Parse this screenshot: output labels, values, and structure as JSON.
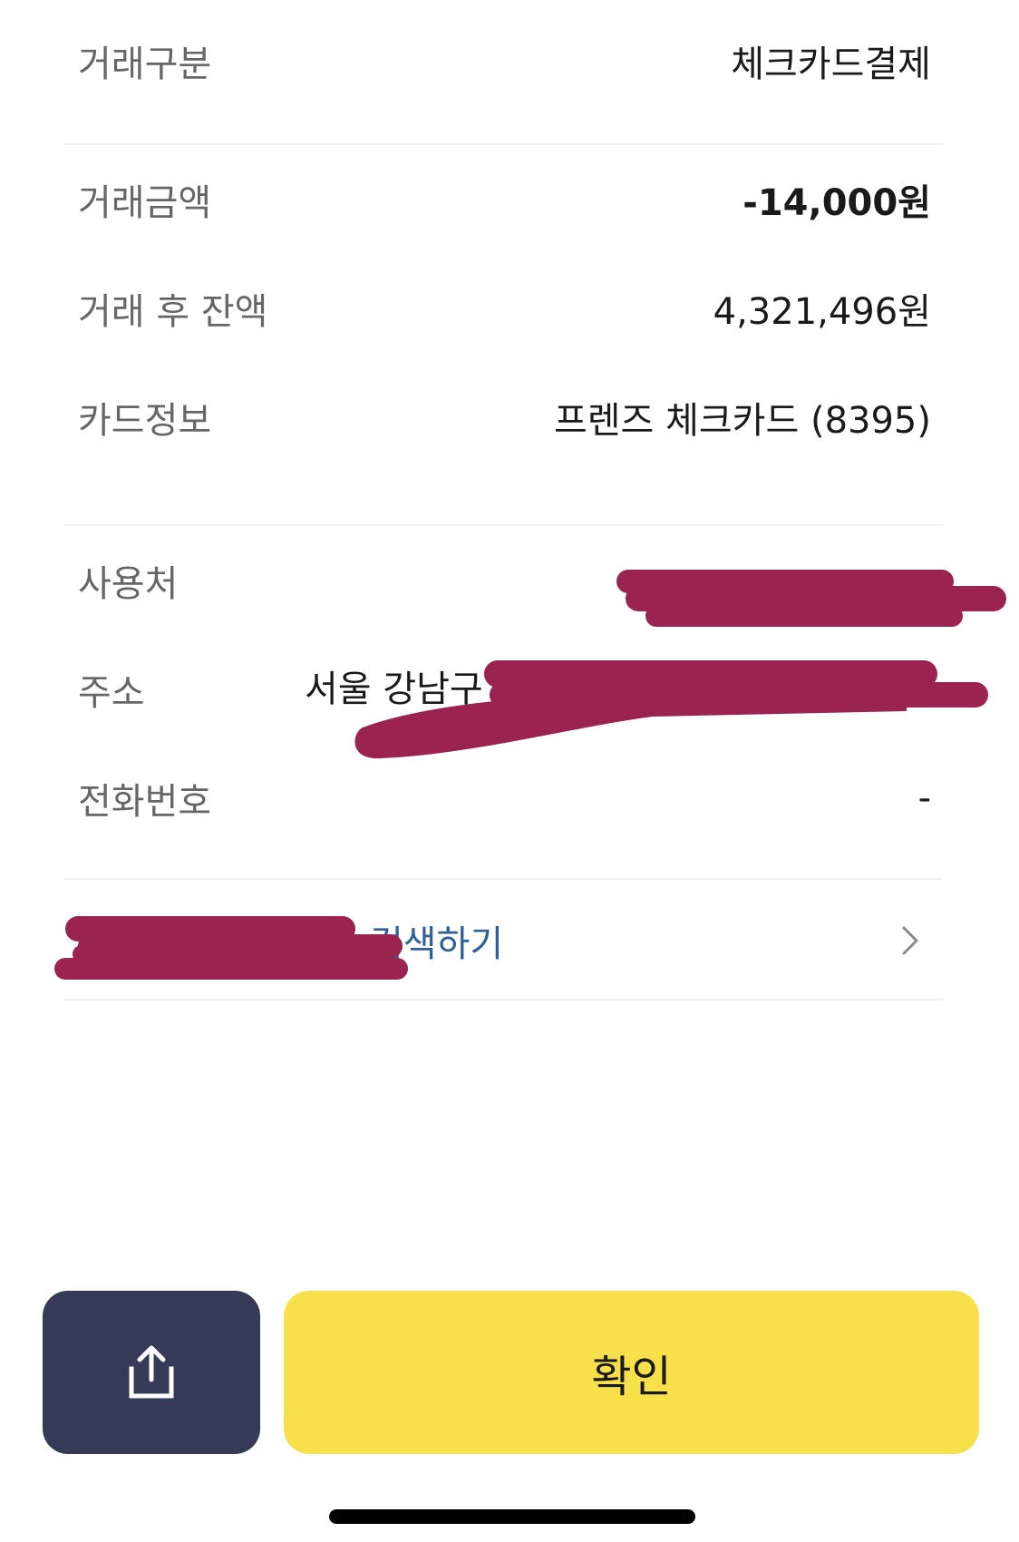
{
  "details": {
    "transaction_type_label": "거래구분",
    "transaction_type_value": "체크카드결제",
    "amount_label": "거래금액",
    "amount_value": "-14,000원",
    "balance_label": "거래 후 잔액",
    "balance_value": "4,321,496원",
    "card_label": "카드정보",
    "card_value": "프렌즈 체크카드 (8395)"
  },
  "merchant": {
    "merchant_label": "사용처",
    "address_label": "주소",
    "address_value": "서울 강남구",
    "phone_label": "전화번호",
    "phone_value": "-"
  },
  "search_link": {
    "label": "검색하기",
    "icon": "chevron-right-icon"
  },
  "actions": {
    "share_icon": "share-icon",
    "confirm_label": "확인"
  },
  "colors": {
    "confirm_button": "#f7e04a",
    "share_button": "#353a56",
    "link": "#2e5f99",
    "redaction": "#9b2350"
  }
}
